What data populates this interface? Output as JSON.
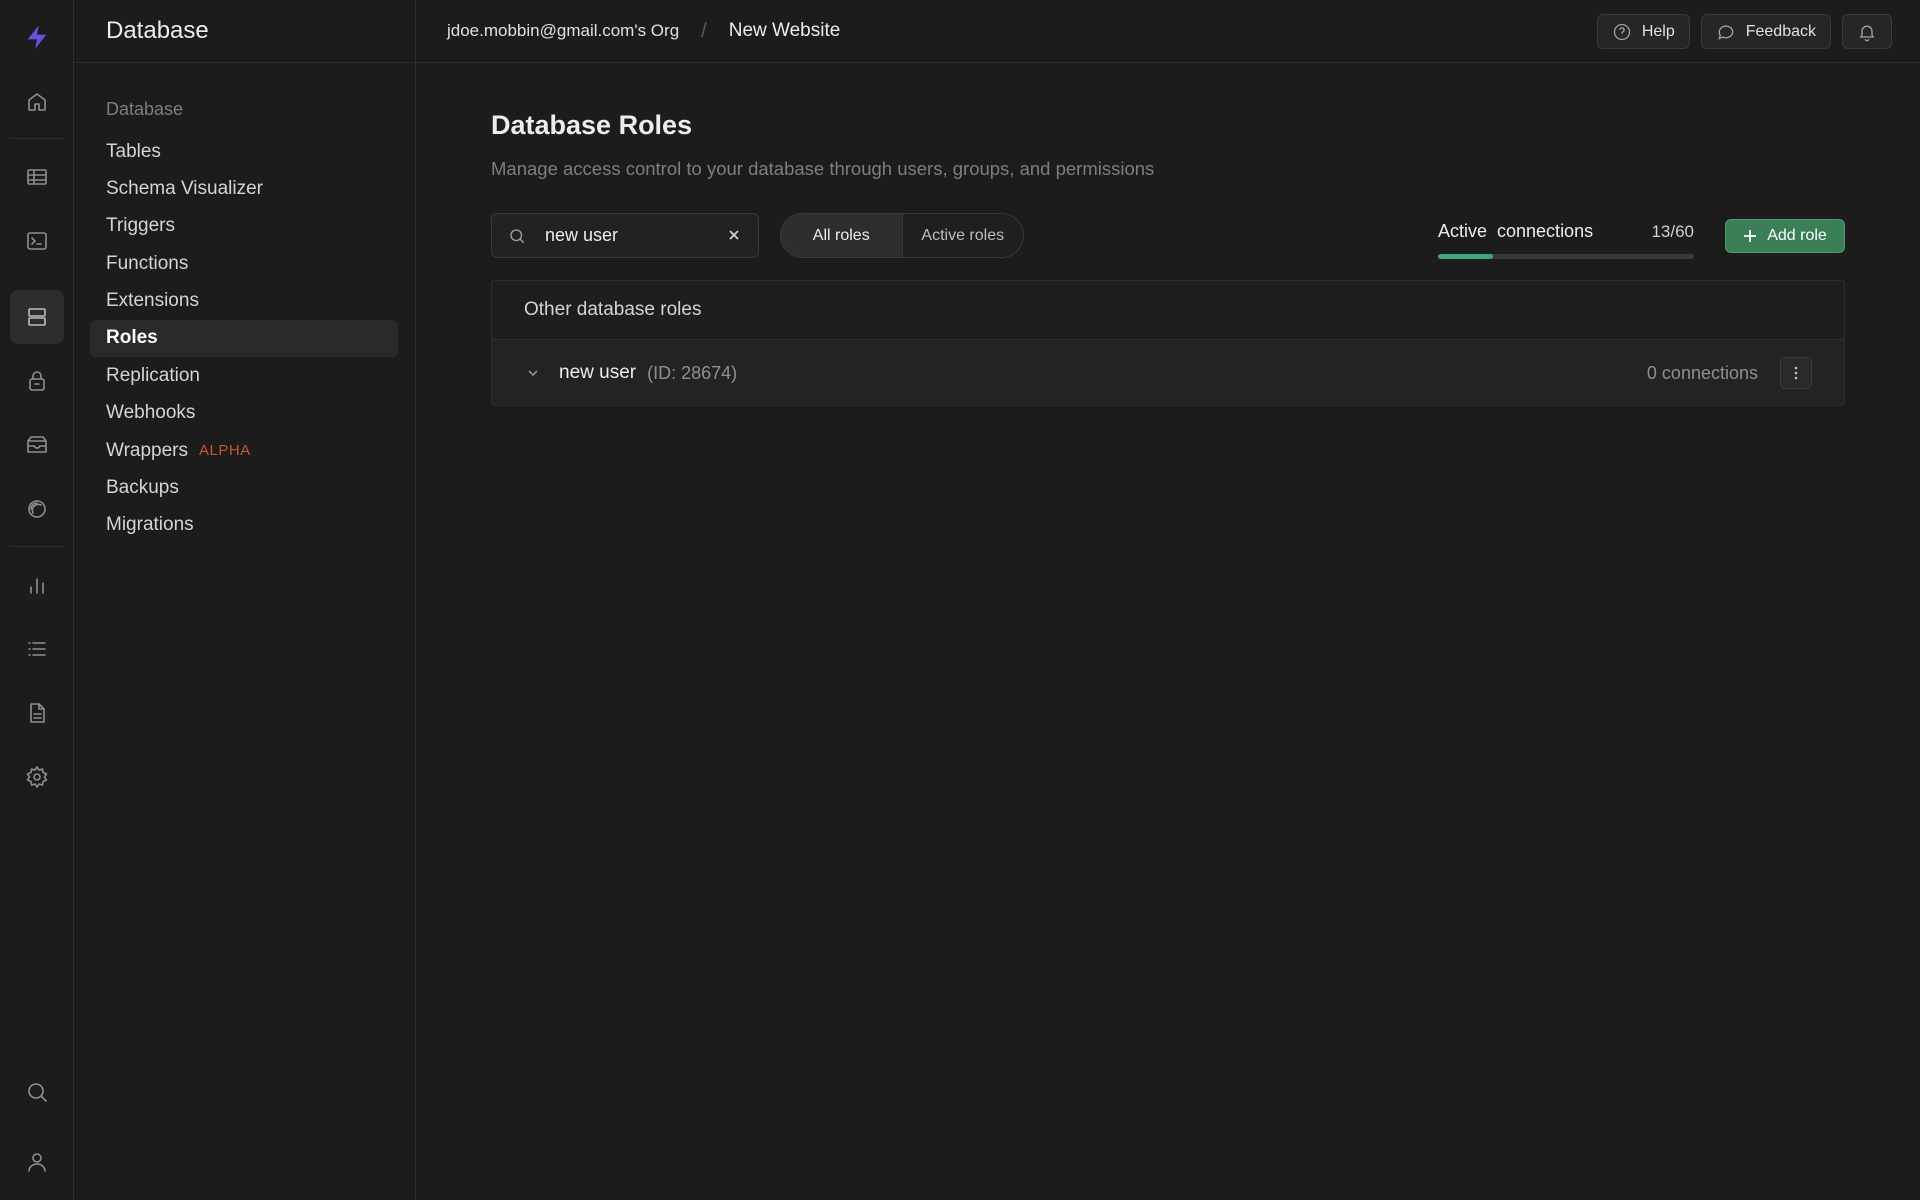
{
  "sidebar": {
    "title": "Database",
    "section_label": "Database",
    "items": [
      {
        "label": "Tables"
      },
      {
        "label": "Schema Visualizer"
      },
      {
        "label": "Triggers"
      },
      {
        "label": "Functions"
      },
      {
        "label": "Extensions"
      },
      {
        "label": "Roles"
      },
      {
        "label": "Replication"
      },
      {
        "label": "Webhooks"
      },
      {
        "label": "Wrappers",
        "badge": "ALPHA"
      },
      {
        "label": "Backups"
      },
      {
        "label": "Migrations"
      }
    ],
    "active_item": "Roles"
  },
  "rail": {
    "icons": [
      "logo-icon",
      "home-icon",
      "table-editor-icon",
      "sql-editor-icon",
      "database-icon",
      "auth-icon",
      "storage-icon",
      "realtime-icon",
      "reports-icon",
      "logs-icon",
      "api-docs-icon",
      "settings-icon",
      "search-icon",
      "user-icon"
    ],
    "accent": "#6c4fe0"
  },
  "topbar": {
    "org": "jdoe.mobbin@gmail.com's Org",
    "separator": "/",
    "project": "New Website",
    "help_label": "Help",
    "feedback_label": "Feedback"
  },
  "page": {
    "title": "Database Roles",
    "subtitle": "Manage access control to your database through users, groups, and permissions"
  },
  "search": {
    "value": "new user",
    "placeholder": "Search for a role"
  },
  "filter": {
    "all_label": "All roles",
    "active_label": "Active roles",
    "selected": "All roles"
  },
  "connections": {
    "label": "Active  connections",
    "value": "13/60",
    "used": 13,
    "max": 60,
    "color": "#3ecf8e"
  },
  "add_role_label": "Add role",
  "roles_panel": {
    "heading": "Other database roles",
    "rows": [
      {
        "name": "new user",
        "id": "(ID: 28674)",
        "connections": "0 connections"
      }
    ]
  }
}
